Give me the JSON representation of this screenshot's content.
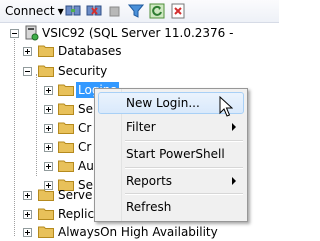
{
  "toolbar": {
    "connect_label": "Connect",
    "icons": [
      "connect-object-explorer-icon",
      "disconnect-icon",
      "stop-icon",
      "filter-icon",
      "refresh-icon",
      "object-explorer-details-icon"
    ]
  },
  "tree": {
    "server_label": "VSIC92 (SQL Server 11.0.2376 -",
    "nodes": {
      "databases": "Databases",
      "security": "Security",
      "logins": "Logins",
      "sec_child_1": "Se",
      "sec_child_2": "Cr",
      "sec_child_3": "Cr",
      "sec_child_4": "Au",
      "sec_child_5": "Se",
      "server_objects": "Serve",
      "replication": "Replic",
      "alwayson": "AlwaysOn High Availability"
    }
  },
  "context_menu": {
    "items": [
      {
        "label": "New Login...",
        "highlighted": true,
        "has_submenu": false
      },
      {
        "label": "Filter",
        "has_submenu": true
      },
      {
        "label": "Start PowerShell",
        "has_submenu": false
      },
      {
        "label": "Reports",
        "has_submenu": true
      },
      {
        "label": "Refresh",
        "has_submenu": false
      }
    ]
  },
  "colors": {
    "selection": "#3399ff",
    "folder": "#e8c15a",
    "menu_bg": "#f0f0f0",
    "menu_highlight_border": "#a8d0f6"
  }
}
